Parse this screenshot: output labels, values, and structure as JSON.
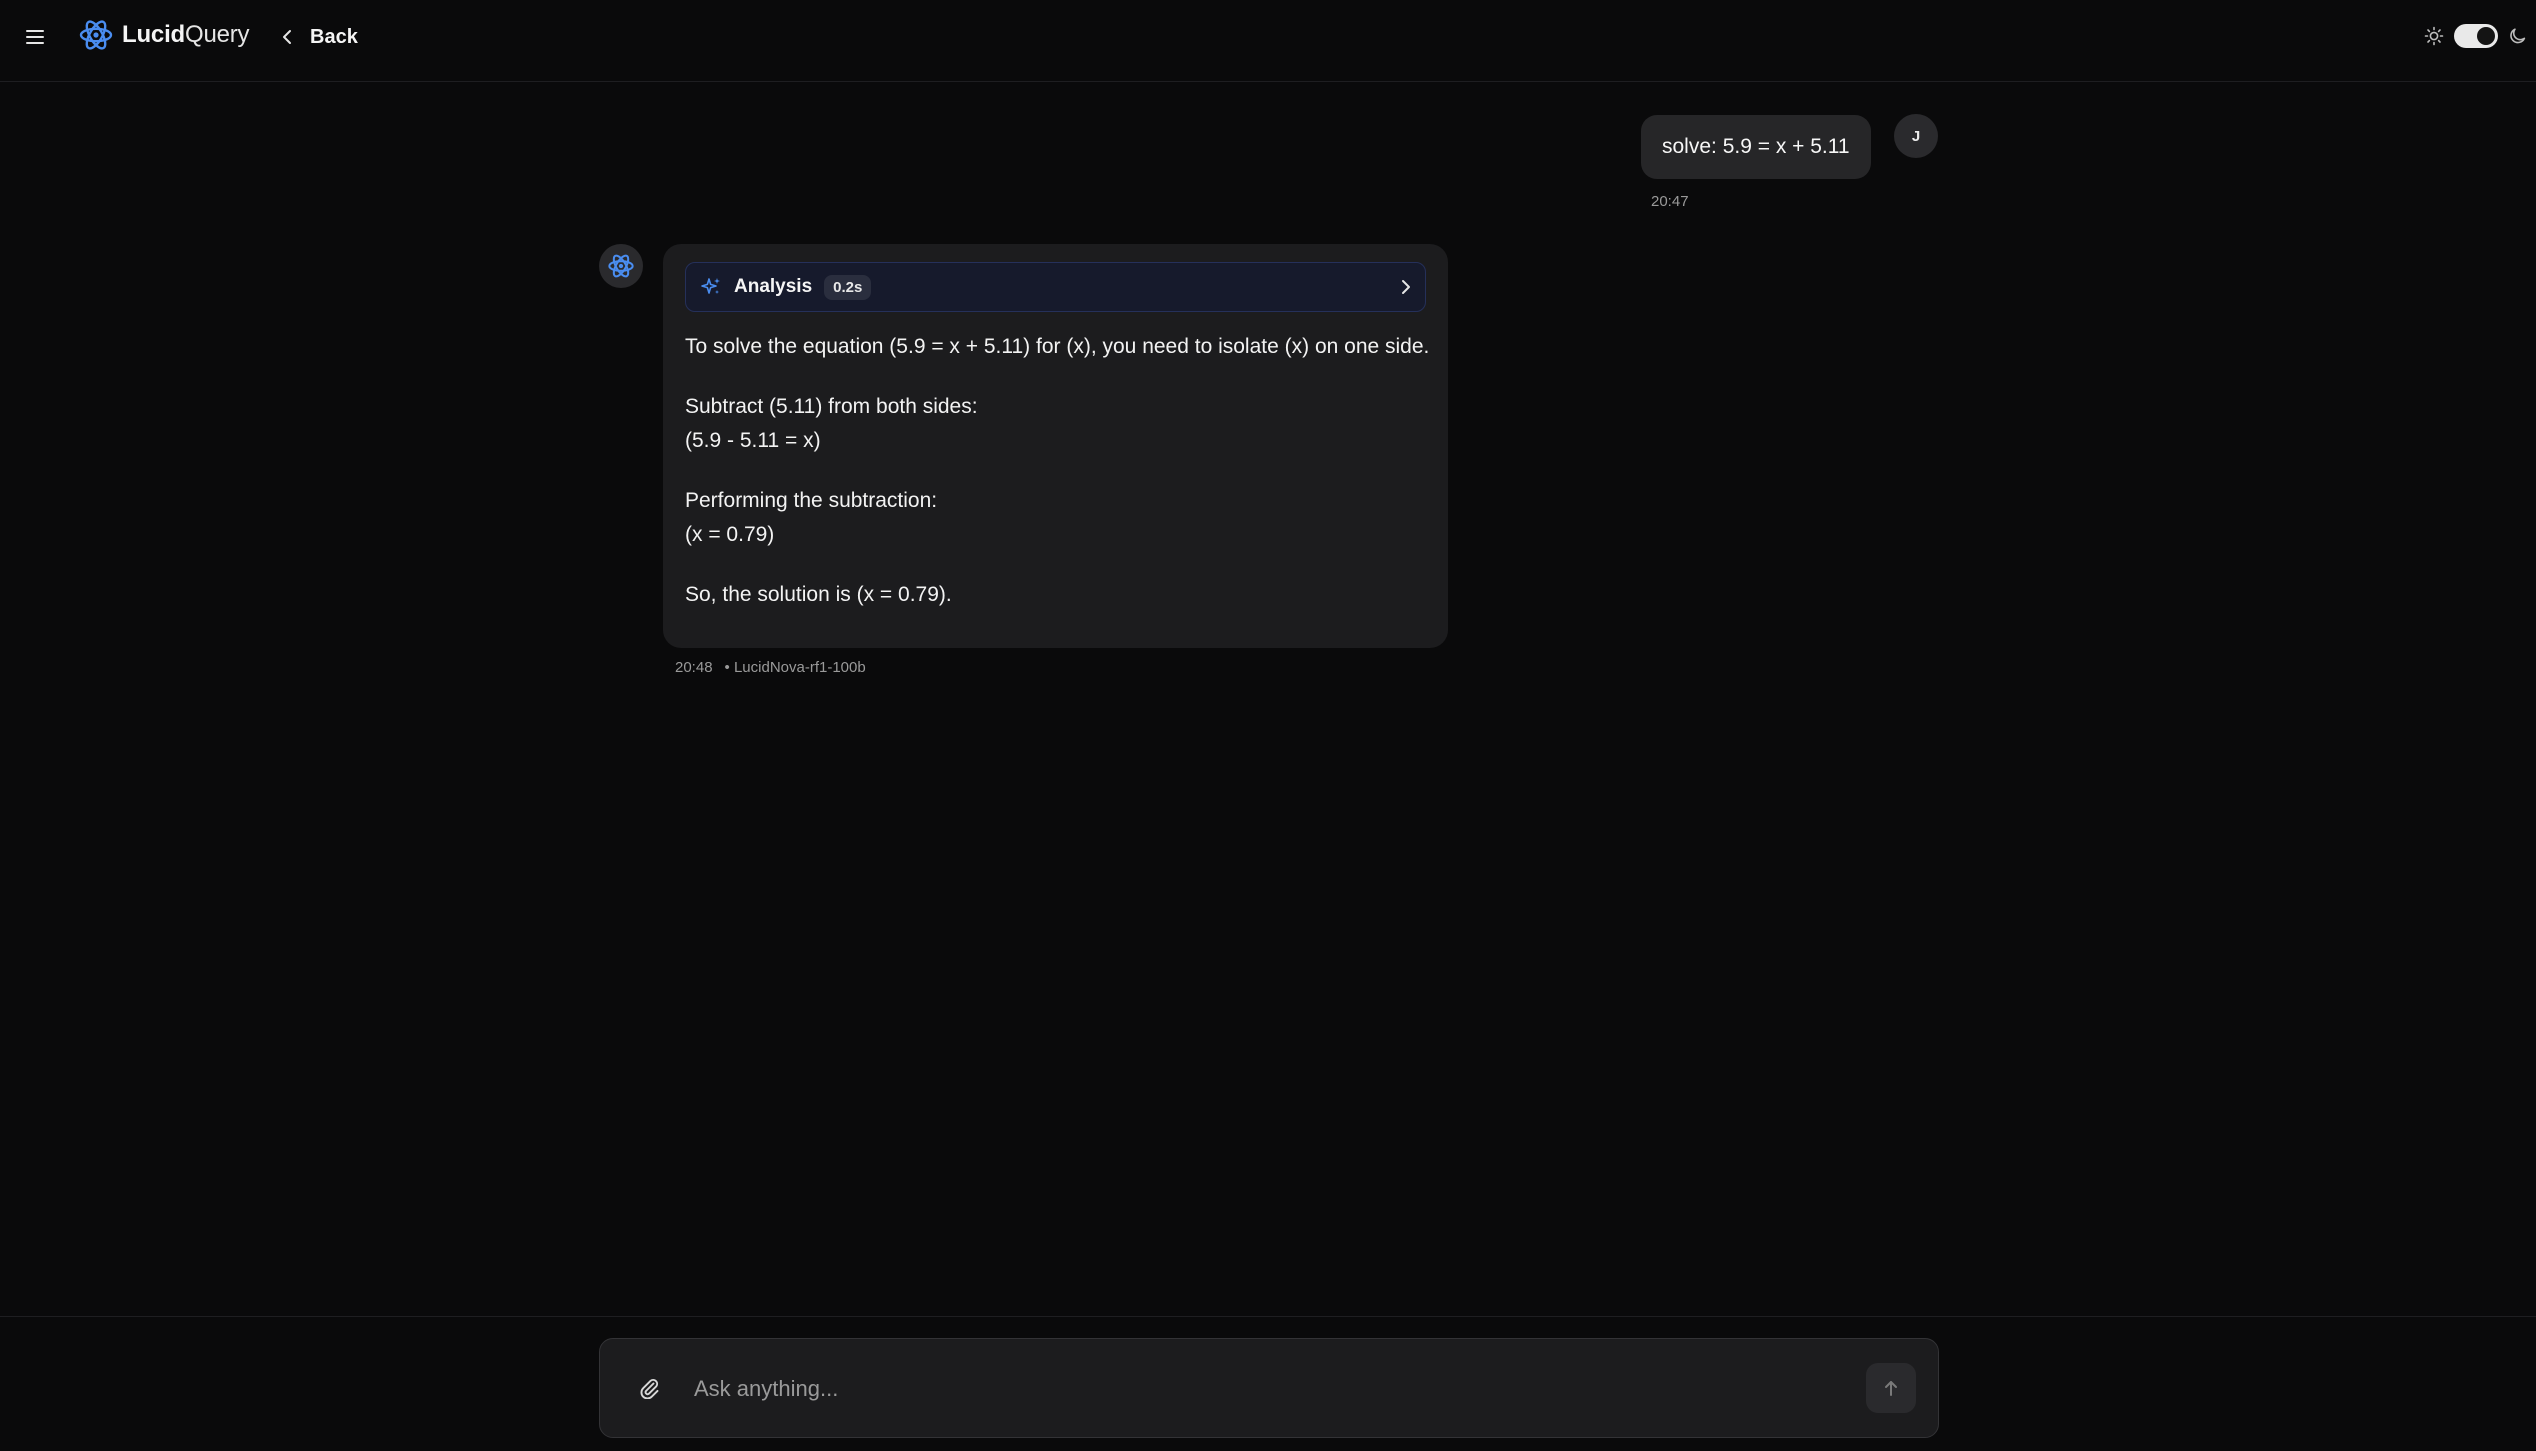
{
  "header": {
    "menu_icon": "hamburger-menu-icon",
    "logo_bold": "Lucid",
    "logo_light": "Query",
    "back_label": "Back"
  },
  "theme": {
    "light_icon": "sun-icon",
    "dark_icon": "moon-icon",
    "mode": "dark"
  },
  "messages": {
    "user": {
      "text": "solve: 5.9 = x + 5.11",
      "time": "20:47",
      "avatar_initial": "J"
    },
    "assistant": {
      "analysis_label": "Analysis",
      "analysis_time": "0.2s",
      "paragraphs": {
        "p1": "To solve the equation (5.9 = x + 5.11) for (x), you need to isolate (x) on one side.",
        "p2_line1": "Subtract (5.11) from both sides:",
        "p2_line2": "(5.9 - 5.11 = x)",
        "p3_line1": "Performing the subtraction:",
        "p3_line2": "(x = 0.79)",
        "p4": "So, the solution is (x = 0.79)."
      },
      "time": "20:48",
      "model": "• LucidNova-rf1-100b"
    }
  },
  "composer": {
    "placeholder": "Ask anything...",
    "value": ""
  },
  "colors": {
    "background": "#0a0a0b",
    "bubble": "#1c1c1e",
    "accent": "#3b82f6",
    "analysis_bg": "#161a2c"
  }
}
